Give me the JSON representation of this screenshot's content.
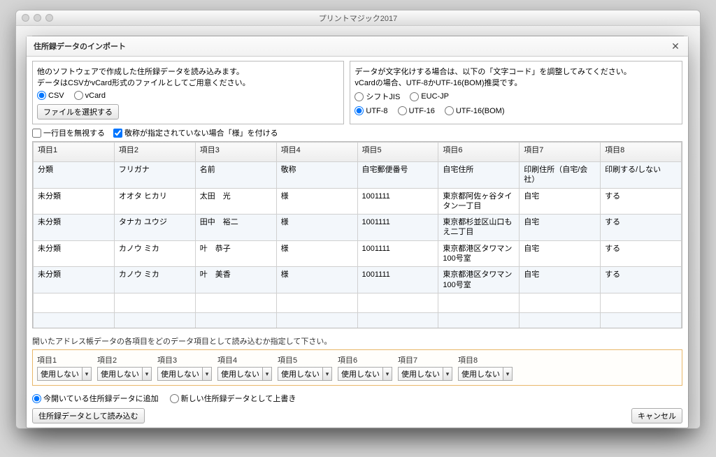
{
  "window": {
    "title": "プリントマジック2017"
  },
  "dialog": {
    "title": "住所録データのインポート",
    "left_note1": "他のソフトウェアで作成した住所録データを読み込みます。",
    "left_note2": "データはCSVかvCard形式のファイルとしてご用意ください。",
    "file_format": {
      "csv": "CSV",
      "vcard": "vCard"
    },
    "select_file_btn": "ファイルを選択する",
    "right_note1": "データが文字化けする場合は、以下の「文字コード」を調整してみてください。",
    "right_note2": "vCardの場合、UTF-8かUTF-16(BOM)推奨です。",
    "encodings": {
      "sjis": "シフトJIS",
      "euc": "EUC-JP",
      "utf8": "UTF-8",
      "utf16": "UTF-16",
      "utf16bom": "UTF-16(BOM)"
    },
    "skip_first_row": "一行目を無視する",
    "append_sama": "敬称が指定されていない場合「様」を付ける",
    "mapping_note": "開いたアドレス帳データの各項目をどのデータ項目として読み込むか指定して下さい。",
    "map_headers": [
      "項目1",
      "項目2",
      "項目3",
      "項目4",
      "項目5",
      "項目6",
      "項目7",
      "項目8"
    ],
    "map_value": "使用しない",
    "import_mode": {
      "append": "今開いている住所録データに追加",
      "overwrite": "新しい住所録データとして上書き"
    },
    "import_btn": "住所録データとして読み込む",
    "cancel_btn": "キャンセル"
  },
  "table": {
    "headers": [
      "項目1",
      "項目2",
      "項目3",
      "項目4",
      "項目5",
      "項目6",
      "項目7",
      "項目8"
    ],
    "rows": [
      [
        "分類",
        "フリガナ",
        "名前",
        "敬称",
        "自宅郵便番号",
        "自宅住所",
        "印刷住所（自宅/会社）",
        "印刷する/しない"
      ],
      [
        "未分類",
        "オオタ ヒカリ",
        "太田　光",
        "様",
        "1001111",
        "東京都阿佐ヶ谷タイタン一丁目",
        "自宅",
        "する"
      ],
      [
        "未分類",
        "タナカ ユウジ",
        "田中　裕二",
        "様",
        "1001111",
        "東京都杉並区山口もえ二丁目",
        "自宅",
        "する"
      ],
      [
        "未分類",
        "カノウ ミカ",
        "叶　恭子",
        "様",
        "1001111",
        "東京都港区タワマン100号室",
        "自宅",
        "する"
      ],
      [
        "未分類",
        "カノウ ミカ",
        "叶　美香",
        "様",
        "1001111",
        "東京都港区タワマン100号室",
        "自宅",
        "する"
      ],
      [
        "",
        "",
        "",
        "",
        "",
        "",
        "",
        ""
      ],
      [
        "",
        "",
        "",
        "",
        "",
        "",
        "",
        ""
      ],
      [
        "",
        "",
        "",
        "",
        "",
        "",
        "",
        ""
      ],
      [
        "",
        "",
        "",
        "",
        "",
        "",
        "",
        ""
      ]
    ]
  }
}
